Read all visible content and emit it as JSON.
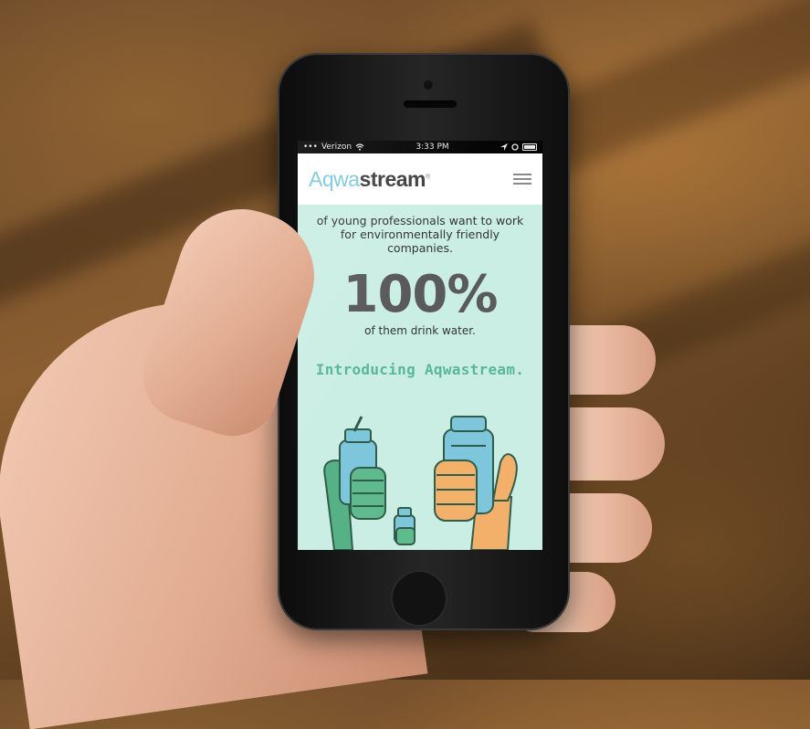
{
  "status_bar": {
    "carrier": "Verizon",
    "time": "3:33 PM"
  },
  "header": {
    "logo_part1": "Aqwa",
    "logo_part2": "stream",
    "logo_mark": "®"
  },
  "content": {
    "intro_text": "of young professionals want to work for environmentally friendly companies.",
    "stat": "100%",
    "stat_caption": "of them drink water.",
    "headline": "Introducing Aqwastream."
  },
  "icons": [
    "signal-icon",
    "wifi-icon",
    "location-icon",
    "alarm-icon",
    "battery-icon",
    "hamburger-menu-icon"
  ],
  "colors": {
    "screen_bg": "#cbeee4",
    "logo_light": "#7cc8dc",
    "logo_dark": "#3f3f3f",
    "headline": "#58b796"
  }
}
